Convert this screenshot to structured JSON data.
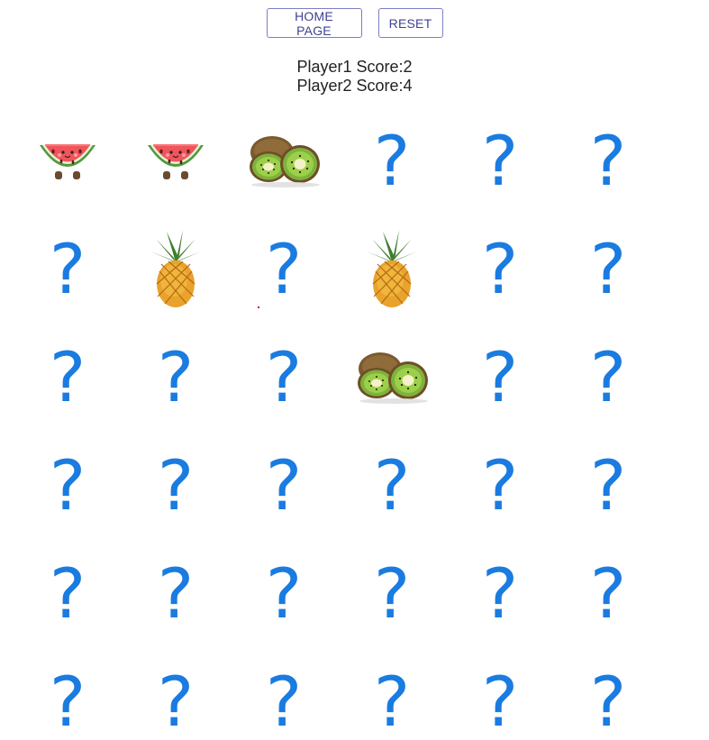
{
  "toolbar": {
    "home_label": "HOME PAGE",
    "reset_label": "RESET"
  },
  "scores": {
    "player1": "Player1 Score:2",
    "player2": "Player2 Score:4"
  },
  "colors": {
    "accent": "#1a7be0",
    "button_text": "#3f4191",
    "button_border": "#7b7fc0"
  },
  "board": {
    "rows": 6,
    "cols": 6,
    "hidden_symbol": "?",
    "cards": [
      "watermelon",
      "watermelon",
      "kiwi",
      "hidden",
      "hidden",
      "hidden",
      "hidden",
      "pineapple",
      "hidden",
      "pineapple",
      "hidden",
      "hidden",
      "hidden",
      "hidden",
      "hidden",
      "kiwi",
      "hidden",
      "hidden",
      "hidden",
      "hidden",
      "hidden",
      "hidden",
      "hidden",
      "hidden",
      "hidden",
      "hidden",
      "hidden",
      "hidden",
      "hidden",
      "hidden",
      "hidden",
      "hidden",
      "hidden",
      "hidden",
      "hidden",
      "hidden"
    ]
  }
}
